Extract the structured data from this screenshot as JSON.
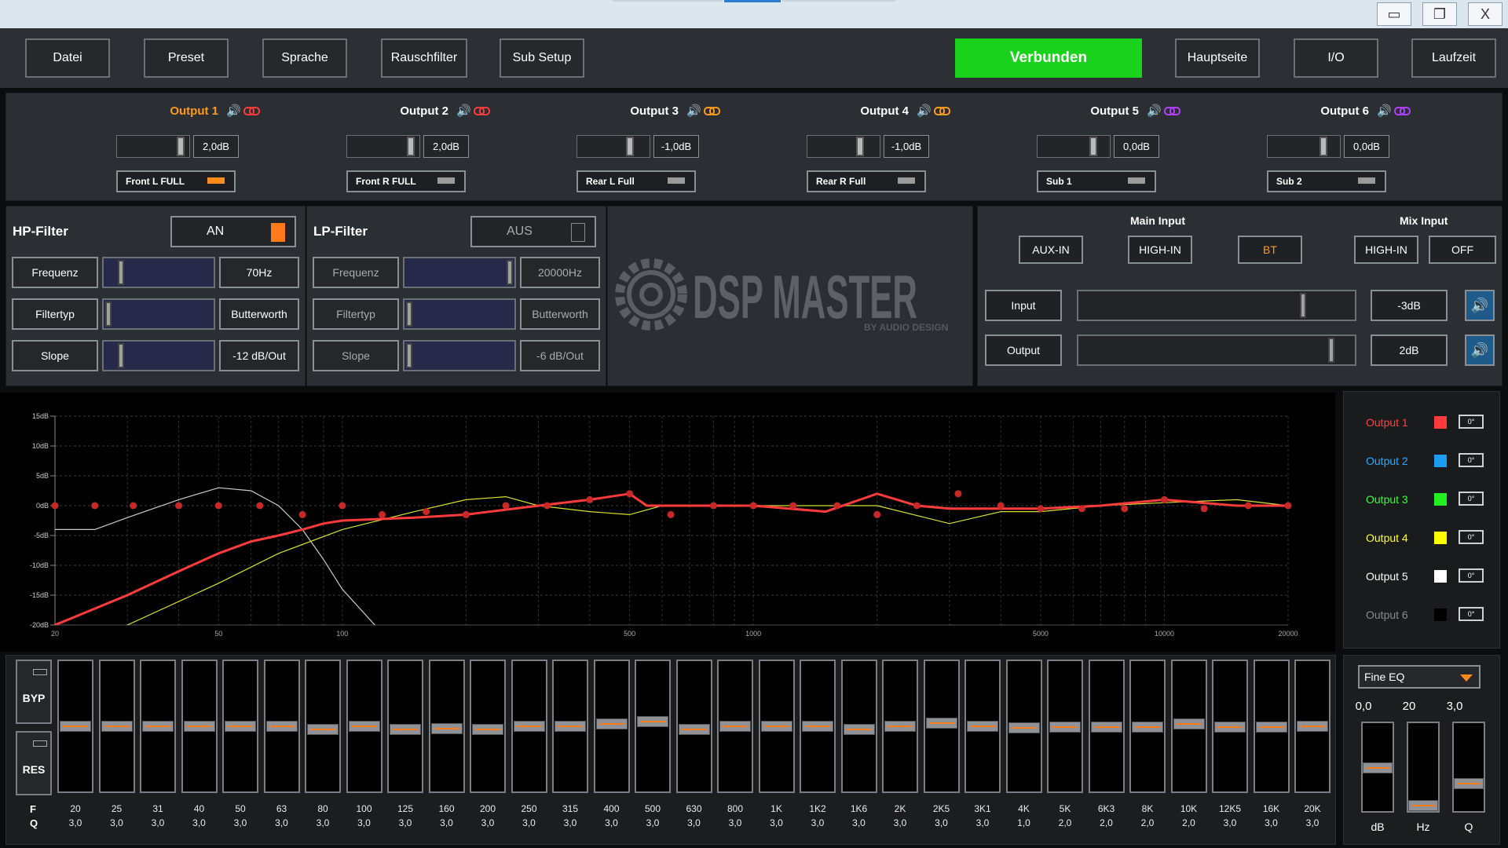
{
  "window": {
    "minimize": "▭",
    "restore": "❐",
    "close": "X"
  },
  "menu": {
    "datei": "Datei",
    "preset": "Preset",
    "sprache": "Sprache",
    "rauschfilter": "Rauschfilter",
    "sub_setup": "Sub Setup",
    "status": "Verbunden",
    "hauptseite": "Hauptseite",
    "io": "I/O",
    "laufzeit": "Laufzeit"
  },
  "outputs": [
    {
      "title": "Output 1",
      "value": "2,0dB",
      "name": "Front L FULL",
      "title_color": "#ff9a1a",
      "link_color": "#ff3b3b",
      "indicator": "#ff8c1a"
    },
    {
      "title": "Output 2",
      "value": "2,0dB",
      "name": "Front R FULL",
      "title_color": "#ffffff",
      "link_color": "#ff3b3b",
      "indicator": "#9a9a9a"
    },
    {
      "title": "Output 3",
      "value": "-1,0dB",
      "name": "Rear L Full",
      "title_color": "#ffffff",
      "link_color": "#ff9a1a",
      "indicator": "#9a9a9a"
    },
    {
      "title": "Output 4",
      "value": "-1,0dB",
      "name": "Rear R Full",
      "title_color": "#ffffff",
      "link_color": "#ff9a1a",
      "indicator": "#9a9a9a"
    },
    {
      "title": "Output 5",
      "value": "0,0dB",
      "name": "Sub 1",
      "title_color": "#ffffff",
      "link_color": "#b040ff",
      "indicator": "#9a9a9a"
    },
    {
      "title": "Output 6",
      "value": "0,0dB",
      "name": "Sub 2",
      "title_color": "#ffffff",
      "link_color": "#b040ff",
      "indicator": "#9a9a9a"
    }
  ],
  "hp_filter": {
    "title": "HP-Filter",
    "state": "AN",
    "freq_label": "Frequenz",
    "freq_value": "70Hz",
    "type_label": "Filtertyp",
    "type_value": "Butterworth",
    "slope_label": "Slope",
    "slope_value": "-12 dB/Out"
  },
  "lp_filter": {
    "title": "LP-Filter",
    "state": "AUS",
    "freq_label": "Frequenz",
    "freq_value": "20000Hz",
    "type_label": "Filtertyp",
    "type_value": "Butterworth",
    "slope_label": "Slope",
    "slope_value": "-6 dB/Out"
  },
  "logo": {
    "main": "DSP MASTER",
    "sub": "BY AUDIO DESIGN"
  },
  "input_panel": {
    "main_input": "Main Input",
    "mix_input": "Mix Input",
    "aux": "AUX-IN",
    "high_in": "HIGH-IN",
    "bt": "BT",
    "mix_high_in": "HIGH-IN",
    "off": "OFF",
    "input_label": "Input",
    "input_value": "-3dB",
    "output_label": "Output",
    "output_value": "2dB"
  },
  "legend": [
    {
      "name": "Output 1",
      "text_color": "#ff4040",
      "swatch": "#ff3b3b",
      "phase": "0°"
    },
    {
      "name": "Output 2",
      "text_color": "#29a8ff",
      "swatch": "#1e9cf0",
      "phase": "0°"
    },
    {
      "name": "Output 3",
      "text_color": "#33ff33",
      "swatch": "#22ee22",
      "phase": "0°"
    },
    {
      "name": "Output 4",
      "text_color": "#ffff33",
      "swatch": "#ffff00",
      "phase": "0°"
    },
    {
      "name": "Output 5",
      "text_color": "#ffffff",
      "swatch": "#ffffff",
      "phase": "0°"
    },
    {
      "name": "Output 6",
      "text_color": "#8a8a8a",
      "swatch": "#000000",
      "phase": "0°"
    }
  ],
  "chart_data": {
    "type": "line",
    "y_ticks": [
      "15dB",
      "10dB",
      "5dB",
      "0dB",
      "-5dB",
      "-10dB",
      "-15dB",
      "-20dB"
    ],
    "x_ticks": [
      "20",
      "50",
      "100",
      "500",
      "1000",
      "5000",
      "10000",
      "20000"
    ],
    "ylim": [
      -20,
      15
    ],
    "xlim": [
      20,
      20000
    ],
    "x_scale": "log",
    "grid": true,
    "series": [
      {
        "color": "#ff3b3b",
        "x": [
          20,
          30,
          40,
          50,
          60,
          70,
          80,
          90,
          100,
          150,
          200,
          300,
          400,
          500,
          550,
          600,
          800,
          1000,
          1500,
          2000,
          2500,
          3000,
          4000,
          5000,
          7000,
          10000,
          15000,
          20000
        ],
        "y": [
          -20,
          -15,
          -11,
          -8,
          -6,
          -5,
          -4,
          -3,
          -2.5,
          -2,
          -1.5,
          0,
          1,
          2,
          0,
          0,
          0,
          0,
          -1,
          2,
          0,
          -0.5,
          -0.5,
          -0.5,
          0,
          1,
          0,
          0
        ]
      },
      {
        "color": "#d8e030",
        "x": [
          20,
          30,
          50,
          70,
          100,
          150,
          200,
          250,
          300,
          400,
          500,
          600,
          800,
          1000,
          1500,
          2000,
          3000,
          4000,
          5000,
          7000,
          10000,
          15000,
          20000
        ],
        "y": [
          -25,
          -20,
          -13,
          -8,
          -4,
          -1,
          1,
          1.5,
          0,
          -1,
          -1.5,
          0,
          0,
          0,
          0,
          0,
          -3,
          -1,
          -1,
          0,
          0.5,
          1,
          0
        ]
      },
      {
        "color": "#cccccc",
        "x": [
          20,
          25,
          30,
          40,
          50,
          60,
          70,
          80,
          90,
          100,
          120,
          150
        ],
        "y": [
          -4,
          -4,
          -2,
          1,
          3,
          2.5,
          0,
          -4,
          -9,
          -14,
          -20,
          -30
        ]
      }
    ],
    "eq_points": [
      {
        "x": 20,
        "y": 0
      },
      {
        "x": 25,
        "y": 0
      },
      {
        "x": 31,
        "y": 0
      },
      {
        "x": 40,
        "y": 0
      },
      {
        "x": 50,
        "y": 0
      },
      {
        "x": 63,
        "y": 0
      },
      {
        "x": 80,
        "y": -1.5
      },
      {
        "x": 100,
        "y": 0
      },
      {
        "x": 125,
        "y": -1.5
      },
      {
        "x": 160,
        "y": -1
      },
      {
        "x": 200,
        "y": -1.5
      },
      {
        "x": 250,
        "y": 0
      },
      {
        "x": 315,
        "y": 0
      },
      {
        "x": 400,
        "y": 1
      },
      {
        "x": 500,
        "y": 2
      },
      {
        "x": 630,
        "y": -1.5
      },
      {
        "x": 800,
        "y": 0
      },
      {
        "x": 1000,
        "y": 0
      },
      {
        "x": 1250,
        "y": 0
      },
      {
        "x": 1600,
        "y": 0
      },
      {
        "x": 2000,
        "y": -1.5
      },
      {
        "x": 2500,
        "y": 0
      },
      {
        "x": 3150,
        "y": 2
      },
      {
        "x": 4000,
        "y": 0
      },
      {
        "x": 5000,
        "y": -0.5
      },
      {
        "x": 6300,
        "y": -0.5
      },
      {
        "x": 8000,
        "y": -0.5
      },
      {
        "x": 10000,
        "y": 1
      },
      {
        "x": 12500,
        "y": -0.5
      },
      {
        "x": 16000,
        "y": 0
      },
      {
        "x": 20000,
        "y": 0
      }
    ]
  },
  "eq": {
    "byp": "BYP",
    "res": "RES",
    "f_label": "F",
    "q_label": "Q",
    "bands": [
      {
        "f": "20",
        "q": "3,0",
        "gain": 0
      },
      {
        "f": "25",
        "q": "3,0",
        "gain": 0
      },
      {
        "f": "31",
        "q": "3,0",
        "gain": 0
      },
      {
        "f": "40",
        "q": "3,0",
        "gain": 0
      },
      {
        "f": "50",
        "q": "3,0",
        "gain": 0
      },
      {
        "f": "63",
        "q": "3,0",
        "gain": 0
      },
      {
        "f": "80",
        "q": "3,0",
        "gain": -1.5
      },
      {
        "f": "100",
        "q": "3,0",
        "gain": 0
      },
      {
        "f": "125",
        "q": "3,0",
        "gain": -1.5
      },
      {
        "f": "160",
        "q": "3,0",
        "gain": -1
      },
      {
        "f": "200",
        "q": "3,0",
        "gain": -1.5
      },
      {
        "f": "250",
        "q": "3,0",
        "gain": 0
      },
      {
        "f": "315",
        "q": "3,0",
        "gain": 0
      },
      {
        "f": "400",
        "q": "3,0",
        "gain": 1
      },
      {
        "f": "500",
        "q": "3,0",
        "gain": 2
      },
      {
        "f": "630",
        "q": "3,0",
        "gain": -1.5
      },
      {
        "f": "800",
        "q": "3,0",
        "gain": 0
      },
      {
        "f": "1K",
        "q": "3,0",
        "gain": 0
      },
      {
        "f": "1K2",
        "q": "3,0",
        "gain": 0
      },
      {
        "f": "1K6",
        "q": "3,0",
        "gain": -1.5
      },
      {
        "f": "2K",
        "q": "3,0",
        "gain": 0
      },
      {
        "f": "2K5",
        "q": "3,0",
        "gain": 1.5
      },
      {
        "f": "3K1",
        "q": "3,0",
        "gain": 0
      },
      {
        "f": "4K",
        "q": "1,0",
        "gain": -0.8
      },
      {
        "f": "5K",
        "q": "2,0",
        "gain": -0.5
      },
      {
        "f": "6K3",
        "q": "2,0",
        "gain": -0.5
      },
      {
        "f": "8K",
        "q": "2,0",
        "gain": -0.5
      },
      {
        "f": "10K",
        "q": "2,0",
        "gain": 1
      },
      {
        "f": "12K5",
        "q": "3,0",
        "gain": -0.5
      },
      {
        "f": "16K",
        "q": "3,0",
        "gain": -0.5
      },
      {
        "f": "20K",
        "q": "3,0",
        "gain": 0
      }
    ]
  },
  "fine_eq": {
    "mode": "Fine EQ",
    "db_value": "0,0",
    "hz_value": "20",
    "q_value": "3,0",
    "db_label": "dB",
    "hz_label": "Hz",
    "q_label": "Q"
  }
}
